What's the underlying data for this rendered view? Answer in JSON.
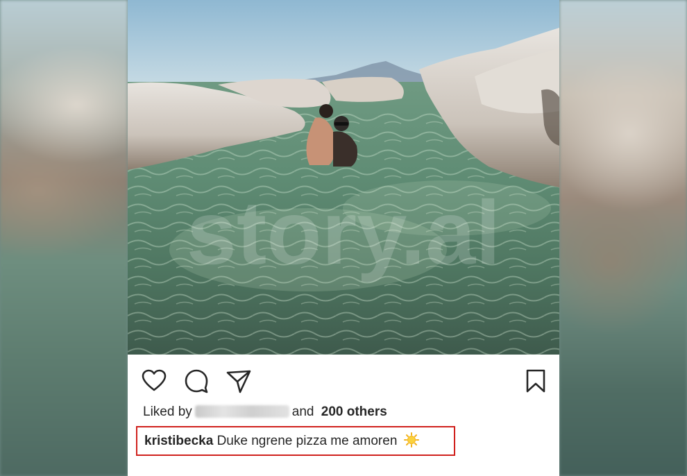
{
  "post": {
    "liked_by_prefix": "Liked by",
    "liked_by_user": "",
    "liked_by_connector": "and",
    "liked_by_others": "200 others",
    "caption_username": "kristibecka",
    "caption_text": "Duke ngrene pizza me amoren",
    "caption_emoji": "sun-emoji",
    "highlight_color": "#d0201c"
  },
  "watermark": "story.al",
  "icons": {
    "like": "heart-icon",
    "comment": "comment-icon",
    "share": "send-icon",
    "save": "bookmark-icon"
  }
}
